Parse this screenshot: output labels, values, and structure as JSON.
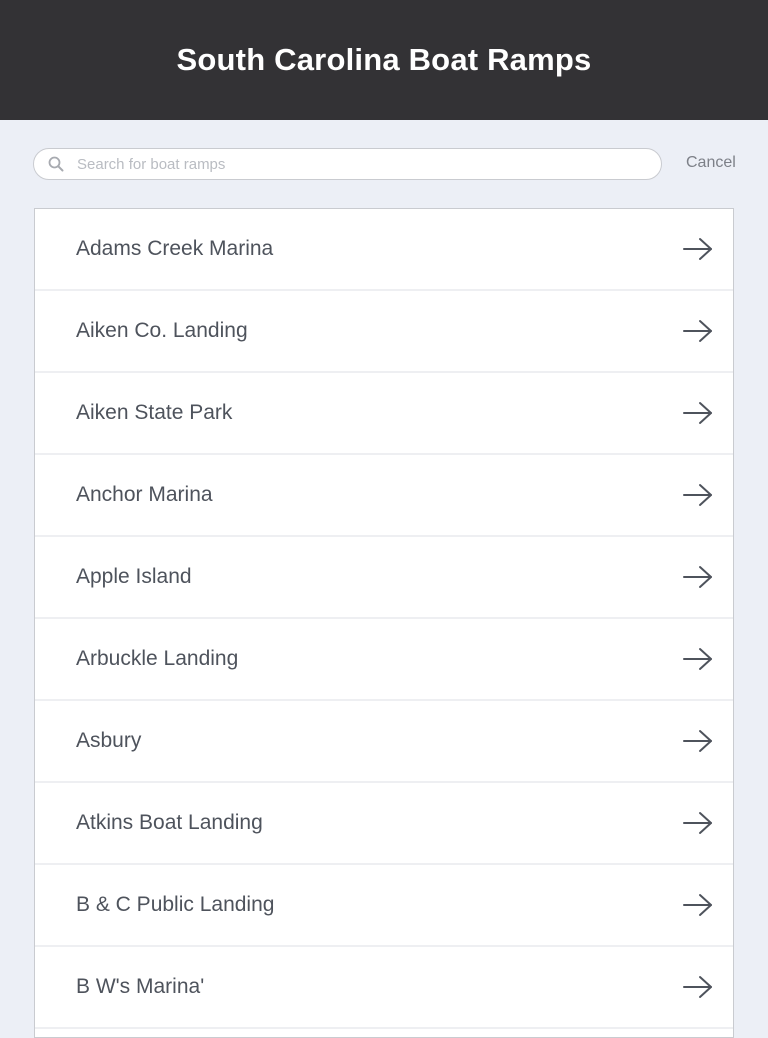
{
  "header": {
    "title": "South Carolina Boat Ramps"
  },
  "search": {
    "placeholder": "Search for boat ramps",
    "value": "",
    "cancel_label": "Cancel"
  },
  "icons": {
    "search": "search-icon",
    "arrow": "arrow-right-icon"
  },
  "colors": {
    "header_bg": "#333235",
    "page_bg": "#eceff6",
    "text": "#4e535c"
  },
  "ramps": [
    "Adams Creek Marina",
    "Aiken Co. Landing",
    "Aiken State Park",
    "Anchor Marina",
    "Apple Island",
    "Arbuckle Landing",
    "Asbury",
    "Atkins Boat Landing",
    "B & C Public Landing",
    "B W's Marina'"
  ]
}
